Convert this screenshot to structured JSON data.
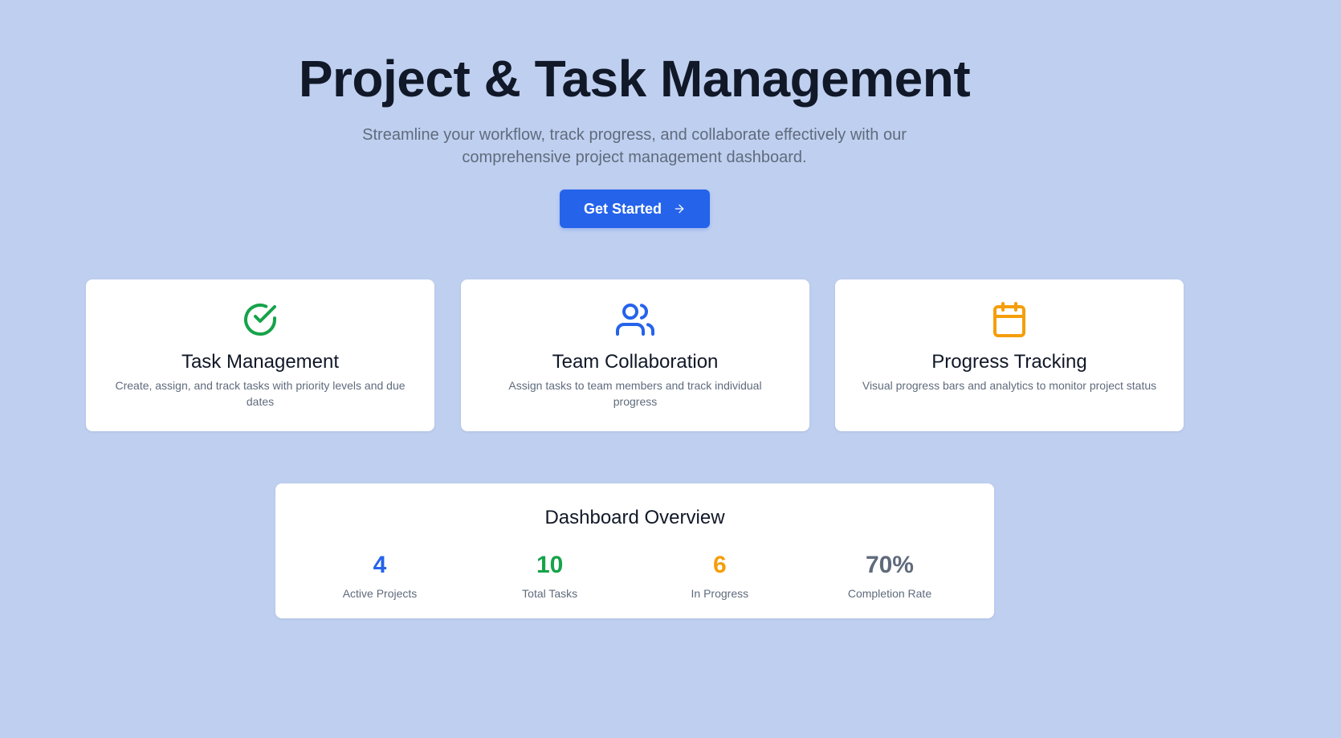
{
  "hero": {
    "title": "Project & Task Management",
    "subtitle": "Streamline your workflow, track progress, and collaborate effectively with our comprehensive project management dashboard.",
    "cta_label": "Get Started",
    "cta_icon": "arrow-right-icon"
  },
  "features": [
    {
      "icon": "check-circle-icon",
      "icon_color": "#16a34a",
      "title": "Task Management",
      "description": "Create, assign, and track tasks with priority levels and due dates"
    },
    {
      "icon": "users-icon",
      "icon_color": "#2563eb",
      "title": "Team Collaboration",
      "description": "Assign tasks to team members and track individual progress"
    },
    {
      "icon": "calendar-icon",
      "icon_color": "#f59e0b",
      "title": "Progress Tracking",
      "description": "Visual progress bars and analytics to monitor project status"
    }
  ],
  "overview": {
    "title": "Dashboard Overview",
    "stats": [
      {
        "value": "4",
        "label": "Active Projects",
        "color": "#2563eb"
      },
      {
        "value": "10",
        "label": "Total Tasks",
        "color": "#16a34a"
      },
      {
        "value": "6",
        "label": "In Progress",
        "color": "#f59e0b"
      },
      {
        "value": "70%",
        "label": "Completion Rate",
        "color": "#5f6b7c"
      }
    ]
  },
  "colors": {
    "background": "#bfcff0",
    "primary": "#2563eb",
    "text_dark": "#111827",
    "text_muted": "#5f6b7c",
    "card": "#ffffff"
  }
}
